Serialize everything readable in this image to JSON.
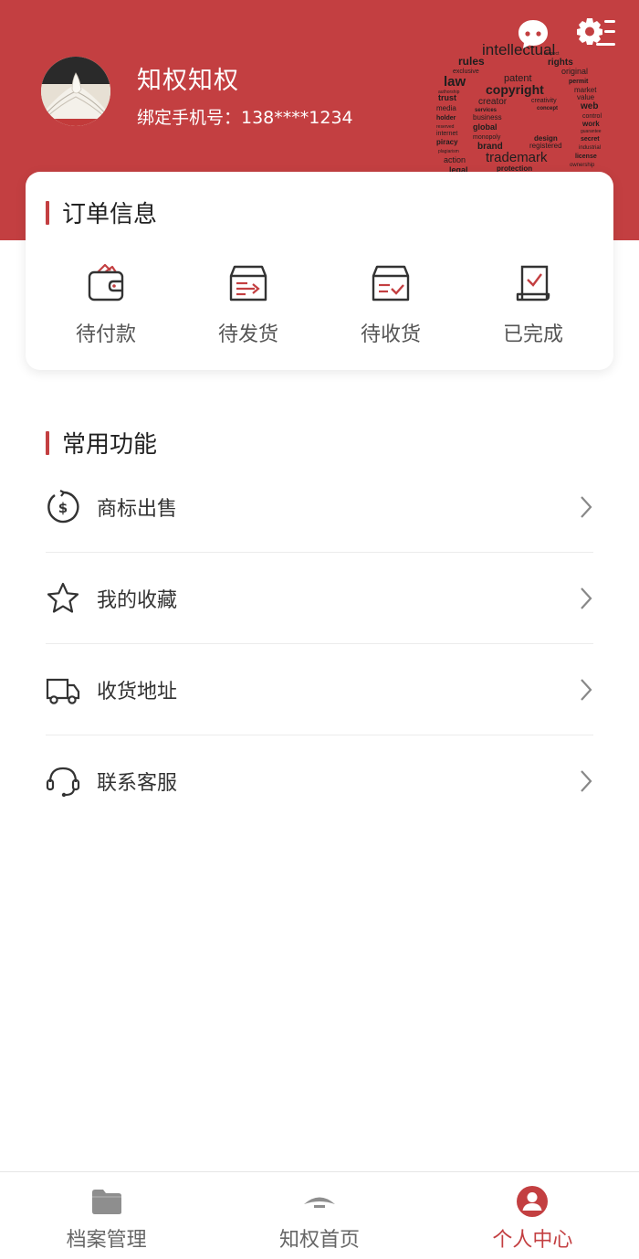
{
  "header": {
    "user_name": "知权知权",
    "phone_label": "绑定手机号：138****1234",
    "message_icon": "message-bubble-icon",
    "settings_icon": "gear-list-icon"
  },
  "orders": {
    "title": "订单信息",
    "items": [
      {
        "label": "待付款",
        "icon": "wallet-icon"
      },
      {
        "label": "待发货",
        "icon": "box-send-icon"
      },
      {
        "label": "待收货",
        "icon": "box-check-icon"
      },
      {
        "label": "已完成",
        "icon": "document-check-icon"
      }
    ]
  },
  "functions": {
    "title": "常用功能",
    "items": [
      {
        "label": "商标出售",
        "icon": "dollar-circle-icon"
      },
      {
        "label": "我的收藏",
        "icon": "star-icon"
      },
      {
        "label": "收货地址",
        "icon": "truck-icon"
      },
      {
        "label": "联系客服",
        "icon": "headset-icon"
      }
    ]
  },
  "bottom_nav": {
    "items": [
      {
        "label": "档案管理",
        "icon": "folder-icon",
        "active": false
      },
      {
        "label": "知权首页",
        "icon": "home-roof-icon",
        "active": false
      },
      {
        "label": "个人中心",
        "icon": "user-circle-icon",
        "active": true
      }
    ]
  },
  "colors": {
    "brand": "#c33f41",
    "text_dark": "#222222",
    "text_muted": "#666666"
  },
  "wordcloud_words": [
    "intellectual",
    "rules",
    "rights",
    "law",
    "patent",
    "copyright",
    "trust",
    "creator",
    "permit",
    "market",
    "value",
    "web",
    "business",
    "global",
    "brand",
    "design",
    "trademark",
    "secret",
    "license",
    "action",
    "legal",
    "piracy",
    "media",
    "holder",
    "internet",
    "exclusive",
    "original",
    "work",
    "concept",
    "services",
    "protection",
    "registered",
    "monopoly",
    "creativity",
    "industrial",
    "ownership",
    "control",
    "guarantee",
    "plagiarism",
    "authorship",
    "reserved",
    "respect"
  ]
}
